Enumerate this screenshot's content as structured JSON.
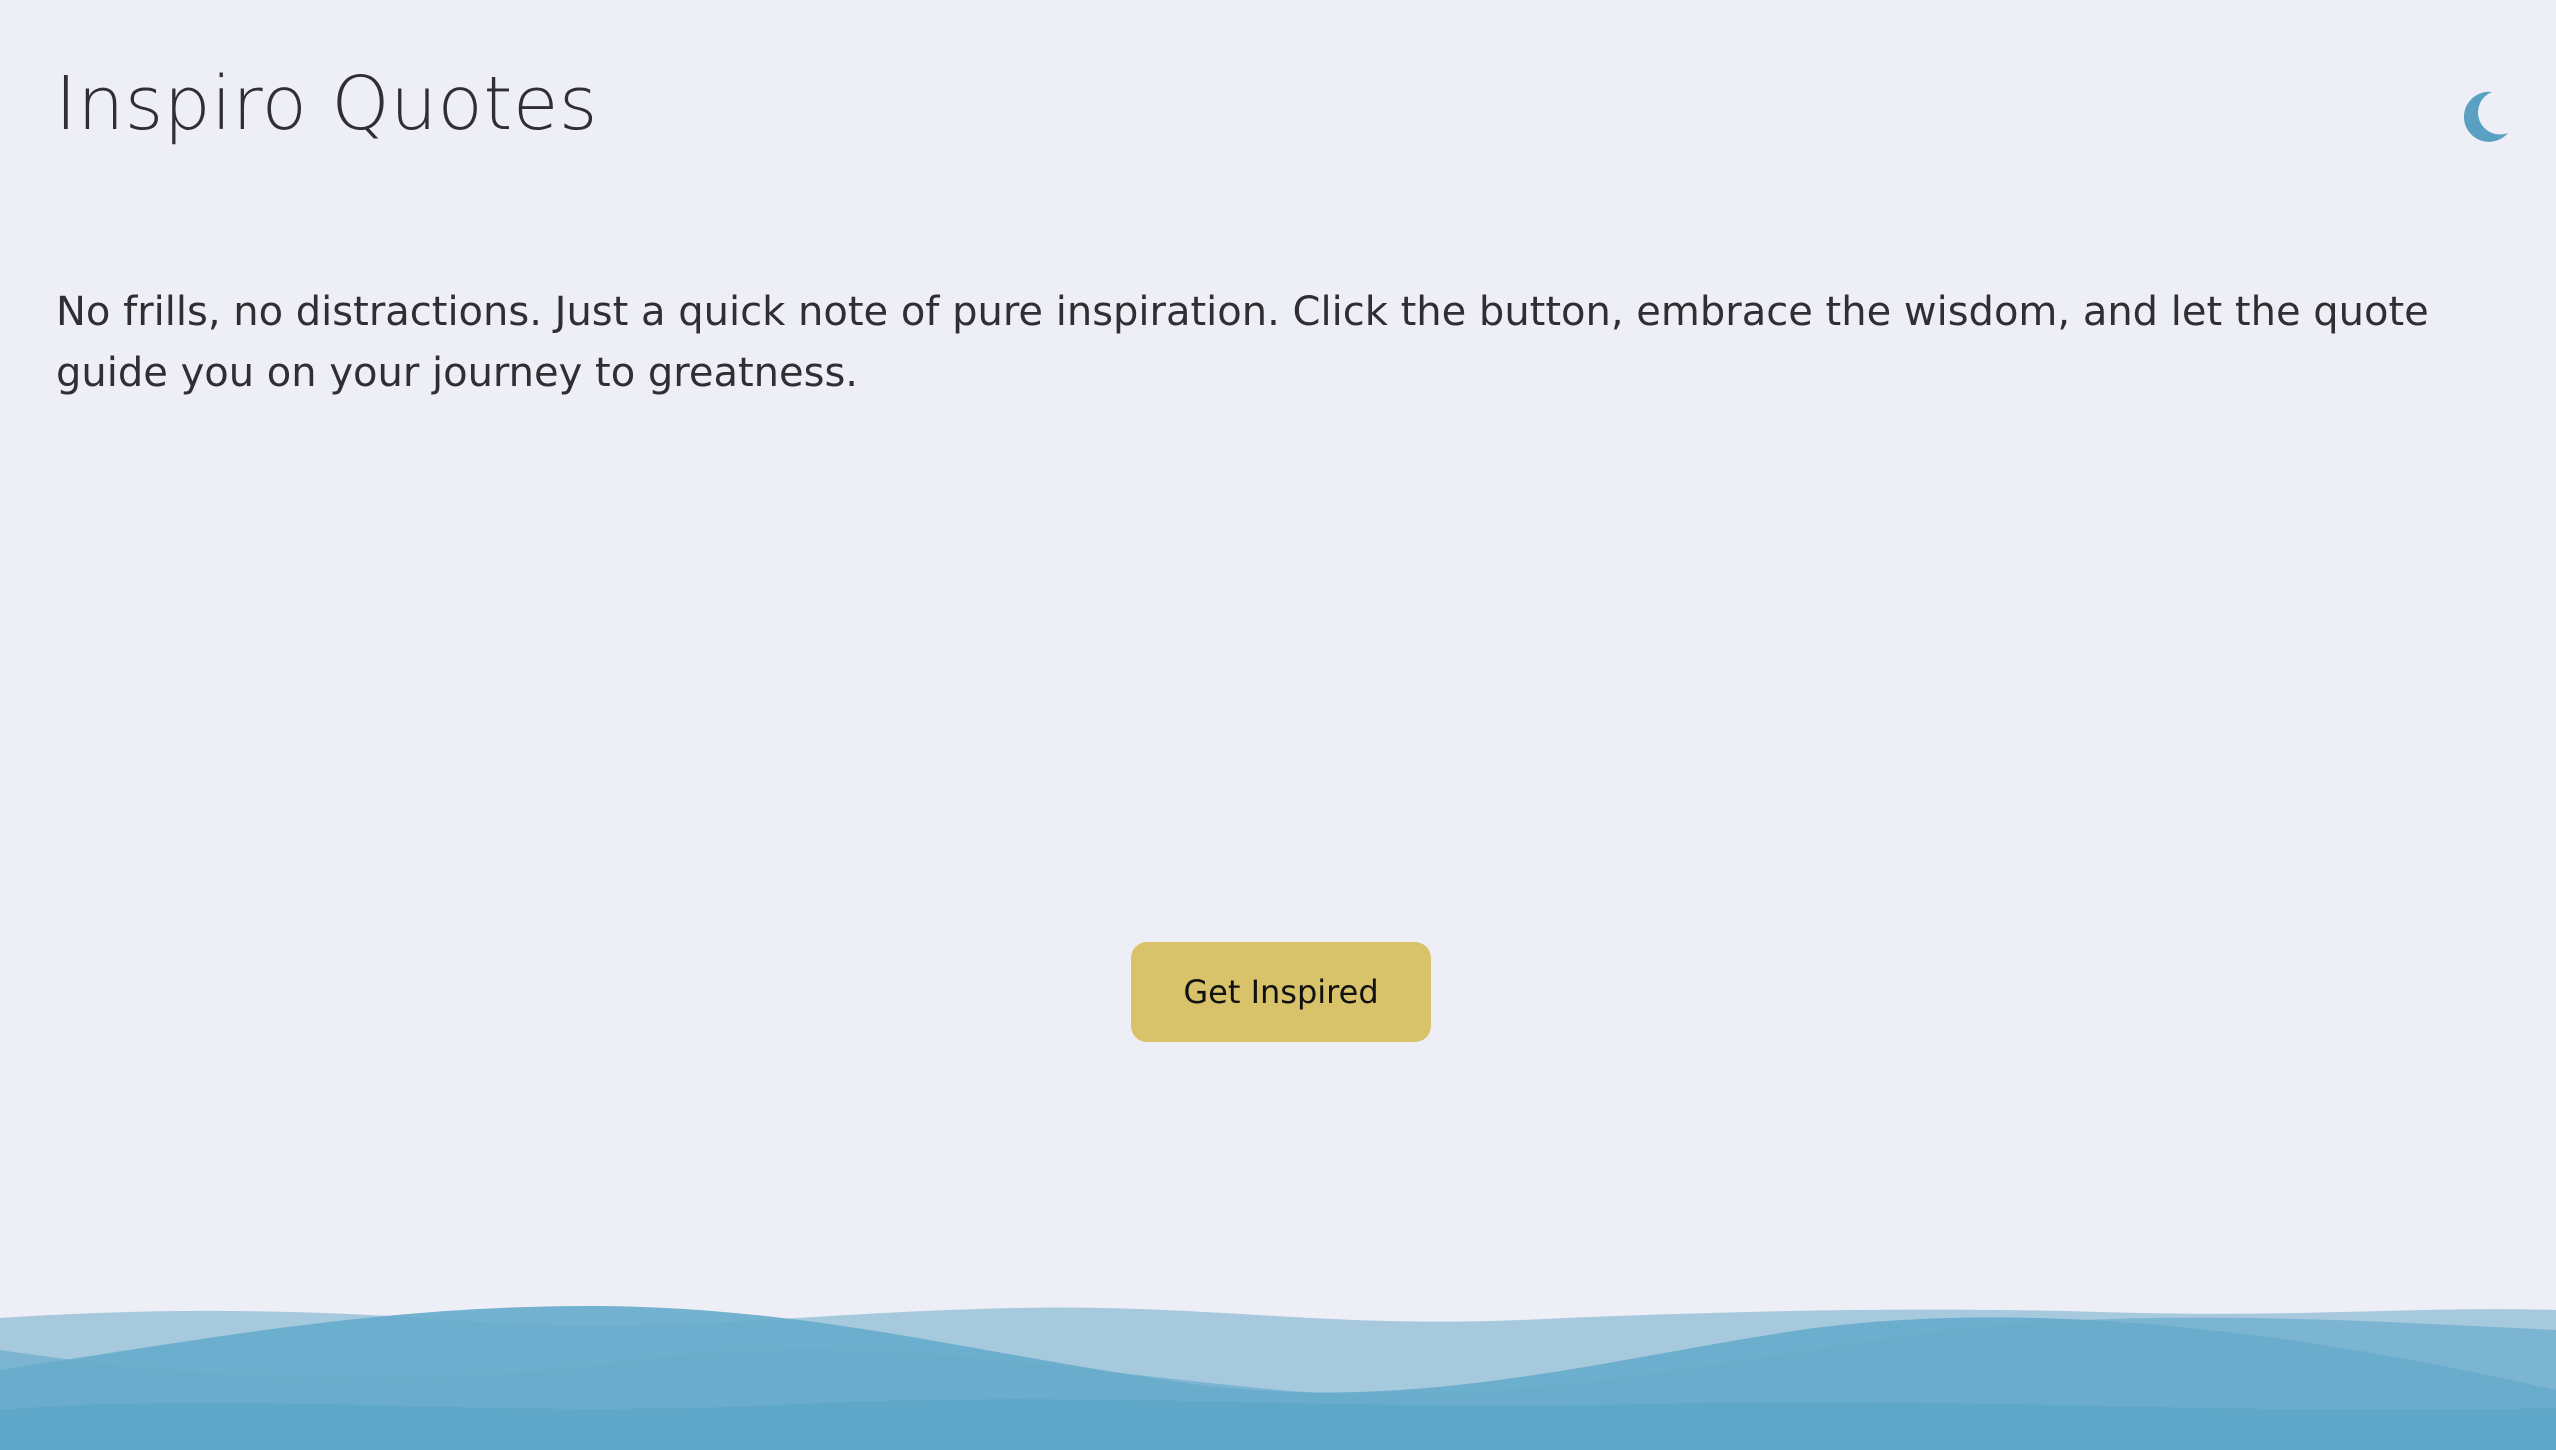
{
  "header": {
    "title": "Inspiro Quotes",
    "theme_toggle_icon": "moon-icon"
  },
  "main": {
    "tagline": "No frills, no distractions. Just a quick note of pure inspiration. Click the button, embrace the wisdom, and let the quote guide you on your journey to greatness.",
    "cta_label": "Get Inspired"
  },
  "colors": {
    "background": "#eeeff6",
    "accent_button": "#d8c26a",
    "wave_blue": "#5ea7c8",
    "moon": "#5aa0c3"
  }
}
